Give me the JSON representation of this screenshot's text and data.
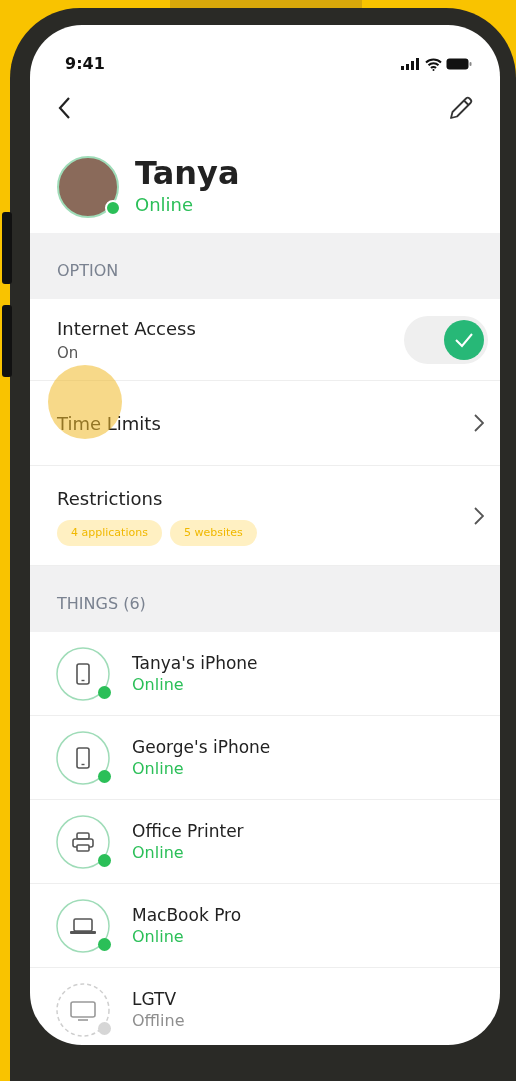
{
  "status_bar": {
    "time": "9:41"
  },
  "profile": {
    "name": "Tanya",
    "status": "Online",
    "online": true
  },
  "option_section": {
    "title": "OPTION"
  },
  "options": [
    {
      "kind": "toggle",
      "label": "Internet Access",
      "subtitle": "On",
      "on": true
    },
    {
      "kind": "link",
      "label": "Time Limits"
    },
    {
      "kind": "link",
      "label": "Restrictions",
      "tags": [
        "4 applications",
        "5 websites"
      ]
    }
  ],
  "things_section": {
    "title": "THINGS (6)"
  },
  "devices": [
    {
      "kind": "phone",
      "name": "Tanya's iPhone",
      "status": "Online",
      "online": true
    },
    {
      "kind": "phone",
      "name": "George's iPhone",
      "status": "Online",
      "online": true
    },
    {
      "kind": "printer",
      "name": "Office Printer",
      "status": "Online",
      "online": true
    },
    {
      "kind": "laptop",
      "name": "MacBook Pro",
      "status": "Online",
      "online": true
    },
    {
      "kind": "tv",
      "name": "LGTV",
      "status": "Offline",
      "online": false
    }
  ]
}
